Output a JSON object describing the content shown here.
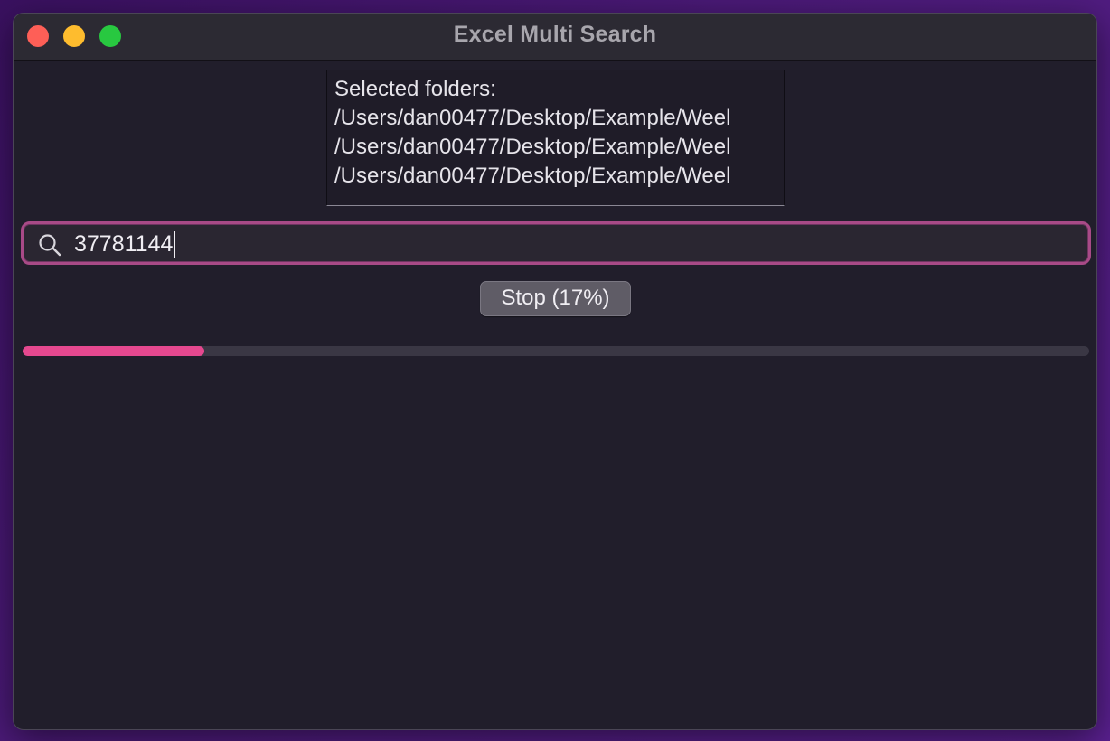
{
  "window": {
    "title": "Excel Multi Search"
  },
  "folders": {
    "heading": "Selected folders:",
    "paths": [
      "/Users/dan00477/Desktop/Example/Weel",
      "/Users/dan00477/Desktop/Example/Weel",
      "/Users/dan00477/Desktop/Example/Weel"
    ]
  },
  "search": {
    "value": "37781144",
    "icon": "search-icon"
  },
  "stop_button": {
    "label": "Stop (17%)"
  },
  "progress": {
    "fraction": 0.17,
    "color": "#e5488f"
  },
  "colors": {
    "accent": "#a84a87",
    "close": "#fe5f57",
    "minimize": "#febc2e",
    "maximize": "#28c840"
  }
}
